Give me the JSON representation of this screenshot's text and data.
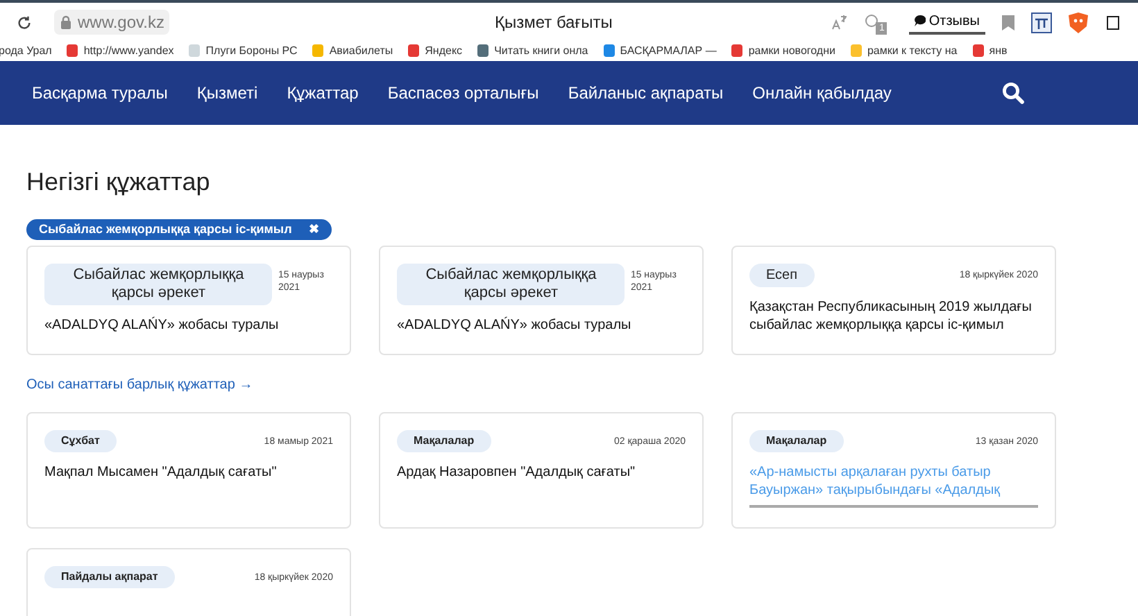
{
  "browser": {
    "url": "www.gov.kz",
    "title": "Қызмет бағыты",
    "tab_badge": "1",
    "feedback": "Отзывы",
    "bookmarks": [
      {
        "label": "рода Урал"
      },
      {
        "label": "http://www.yandex",
        "color": "#e53935"
      },
      {
        "label": "Плуги Бороны РС",
        "color": "#cfd8dc"
      },
      {
        "label": "Авиабилеты",
        "color": "#f5b700"
      },
      {
        "label": "Яндекс",
        "color": "#e53935"
      },
      {
        "label": "Читать книги онла",
        "color": "#546e7a"
      },
      {
        "label": "БАСҚАРМАЛАР —",
        "color": "#1e88e5"
      },
      {
        "label": "рамки новогодни",
        "color": "#e53935"
      },
      {
        "label": "рамки к тексту на",
        "color": "#fbc02d"
      },
      {
        "label": "янв",
        "color": "#e53935"
      }
    ]
  },
  "nav": {
    "items": [
      "Басқарма туралы",
      "Қызметі",
      "Құжаттар",
      "Баспасөз орталығы",
      "Байланыс ақпараты",
      "Онлайн қабылдау"
    ]
  },
  "heading": "Негізгі құжаттар",
  "filter_chip": {
    "label": "Сыбайлас жемқорлыққа қарсы іс-қимыл",
    "close": "✖"
  },
  "top_cards": [
    {
      "kind": "large-tag",
      "tag": "Сыбайлас жемқорлыққа қарсы әрекет",
      "date": "15 наурыз 2021",
      "title": "«ADALDYQ ALAŃY» жобасы туралы",
      "highlighted": false
    },
    {
      "kind": "large-tag",
      "tag": "Сыбайлас жемқорлыққа қарсы әрекет",
      "date": "15 наурыз 2021",
      "title": "«ADALDYQ ALAŃY» жобасы туралы",
      "highlighted": false
    },
    {
      "kind": "plain-tag",
      "tag": "Есеп",
      "date": "18 қыркүйек 2020",
      "title": "Қазақстан Республикасының 2019 жылдағы сыбайлас жемқорлыққа қарсы іс-қимыл",
      "highlighted": false
    }
  ],
  "all_link": {
    "label": "Осы санаттағы барлық құжаттар",
    "arrow": "→"
  },
  "bottom_cards": [
    {
      "kind": "small-tag",
      "tag": "Сұхбат",
      "date": "18 мамыр 2021",
      "title": "Мақпал Мысамен \"Адалдық сағаты\"",
      "highlighted": false
    },
    {
      "kind": "small-tag",
      "tag": "Мақалалар",
      "date": "02 қараша 2020",
      "title": "Ардақ Назаровпен \"Адалдық сағаты\"",
      "highlighted": false
    },
    {
      "kind": "small-tag",
      "tag": "Мақалалар",
      "date": "13 қазан 2020",
      "title": "«Ар-намысты арқалаған рухты батыр Бауыржан» тақырыбындағы «Адалдық",
      "highlighted": true
    },
    {
      "kind": "small-tag",
      "tag": "Пайдалы ақпарат",
      "date": "18 қыркүйек 2020"
    }
  ]
}
